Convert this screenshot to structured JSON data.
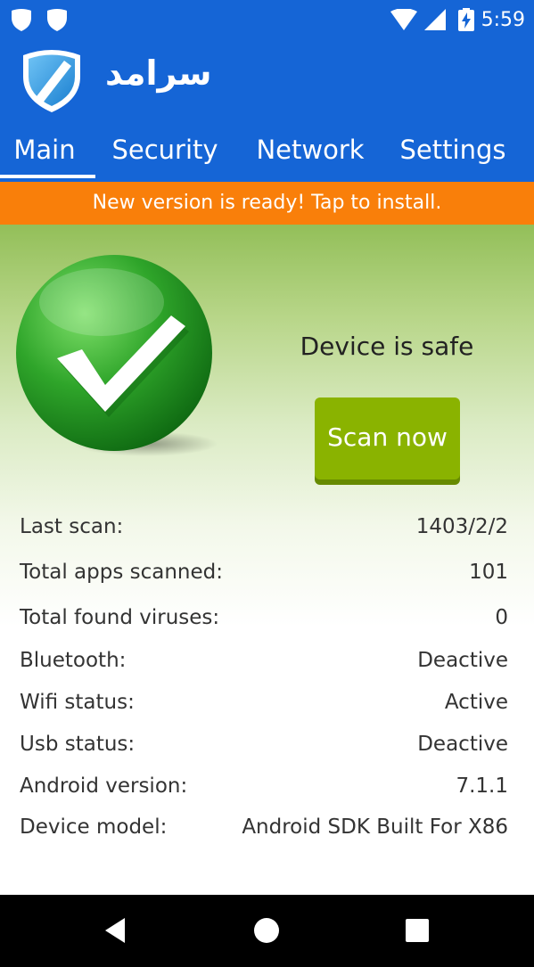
{
  "status_bar": {
    "time": "5:59",
    "icons": [
      "shield-notification-icon",
      "shield-notification-icon",
      "wifi-icon",
      "signal-icon",
      "battery-charging-icon"
    ]
  },
  "app": {
    "brand_name": "سرامد",
    "logo_icon": "shield-logo-icon"
  },
  "tabs": [
    {
      "label": "Main",
      "active": true
    },
    {
      "label": "Security",
      "active": false
    },
    {
      "label": "Network",
      "active": false
    },
    {
      "label": "Settings",
      "active": false
    }
  ],
  "banner": {
    "text": "New version is ready! Tap to install."
  },
  "status": {
    "text": "Device is safe",
    "icon": "green-check-icon",
    "scan_button_label": "Scan now"
  },
  "info": [
    {
      "label": "Last scan:",
      "value": "1403/2/2"
    },
    {
      "label": "Total apps scanned:",
      "value": "101"
    },
    {
      "label": "Total found viruses:",
      "value": "0"
    },
    {
      "label": "Bluetooth:",
      "value": "Deactive"
    },
    {
      "label": "Wifi status:",
      "value": "Active"
    },
    {
      "label": "Usb status:",
      "value": "Deactive"
    },
    {
      "label": "Android version:",
      "value": "7.1.1"
    },
    {
      "label": "Device model:",
      "value": "Android SDK Built For X86"
    }
  ],
  "colors": {
    "primary": "#1565d6",
    "banner": "#f97f0a",
    "scan_button": "#8ab300",
    "safe_green": "#2fa52a"
  },
  "nav_bar": [
    "back-icon",
    "home-icon",
    "recents-icon"
  ]
}
